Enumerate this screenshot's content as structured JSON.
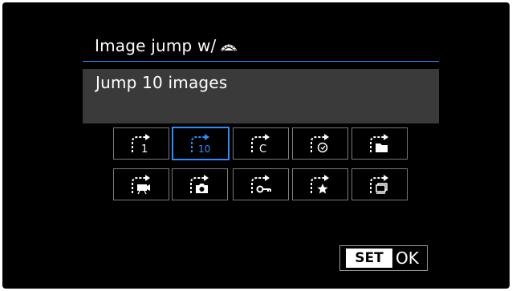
{
  "colors": {
    "accent": "#2f8cff",
    "background": "#000000",
    "value_box": "#3a3a3a",
    "tile_border": "#7a7a7a"
  },
  "menu": {
    "title": "Image jump w/",
    "title_icon": "main-dial-icon"
  },
  "current": {
    "value": "Jump 10 images"
  },
  "options": [
    {
      "icon": "jump-1-image-icon",
      "glyph": "1",
      "selected": false
    },
    {
      "icon": "jump-10-images-icon",
      "glyph": "10",
      "selected": true
    },
    {
      "icon": "jump-specified-images-icon",
      "glyph": "C",
      "selected": false
    },
    {
      "icon": "jump-by-date-icon",
      "glyph": "",
      "selected": false
    },
    {
      "icon": "jump-by-folder-icon",
      "glyph": "",
      "selected": false
    },
    {
      "icon": "jump-movies-icon",
      "glyph": "",
      "selected": false
    },
    {
      "icon": "jump-stills-icon",
      "glyph": "",
      "selected": false
    },
    {
      "icon": "jump-protected-icon",
      "glyph": "",
      "selected": false
    },
    {
      "icon": "jump-by-rating-icon",
      "glyph": "",
      "selected": false
    },
    {
      "icon": "jump-by-series-icon",
      "glyph": "",
      "selected": false
    }
  ],
  "footer": {
    "set_label": "SET",
    "ok_label": "OK"
  }
}
